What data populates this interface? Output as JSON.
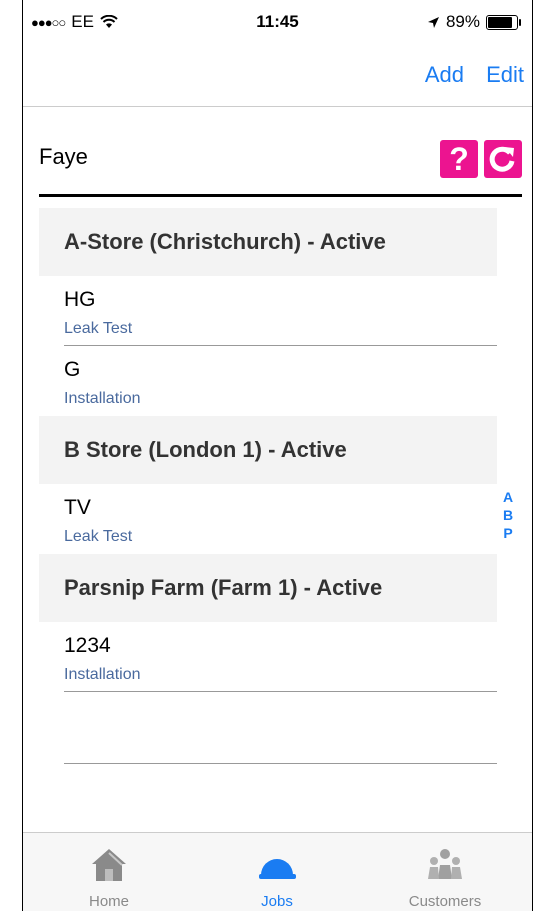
{
  "status": {
    "carrier": "EE",
    "time": "11:45",
    "battery": "89%"
  },
  "nav": {
    "add": "Add",
    "edit": "Edit"
  },
  "user": {
    "name": "Faye",
    "help": "?",
    "refresh": "C"
  },
  "sections": [
    {
      "header": "A-Store (Christchurch) - Active",
      "rows": [
        {
          "title": "HG",
          "subtitle": "Leak Test"
        },
        {
          "title": "G",
          "subtitle": "Installation"
        }
      ]
    },
    {
      "header": "B Store (London 1) - Active",
      "rows": [
        {
          "title": "TV",
          "subtitle": "Leak Test"
        }
      ]
    },
    {
      "header": "Parsnip Farm (Farm 1) - Active",
      "rows": [
        {
          "title": "1234",
          "subtitle": "Installation"
        }
      ]
    }
  ],
  "index": [
    "A",
    "B",
    "P"
  ],
  "tabs": {
    "home": "Home",
    "jobs": "Jobs",
    "customers": "Customers"
  }
}
